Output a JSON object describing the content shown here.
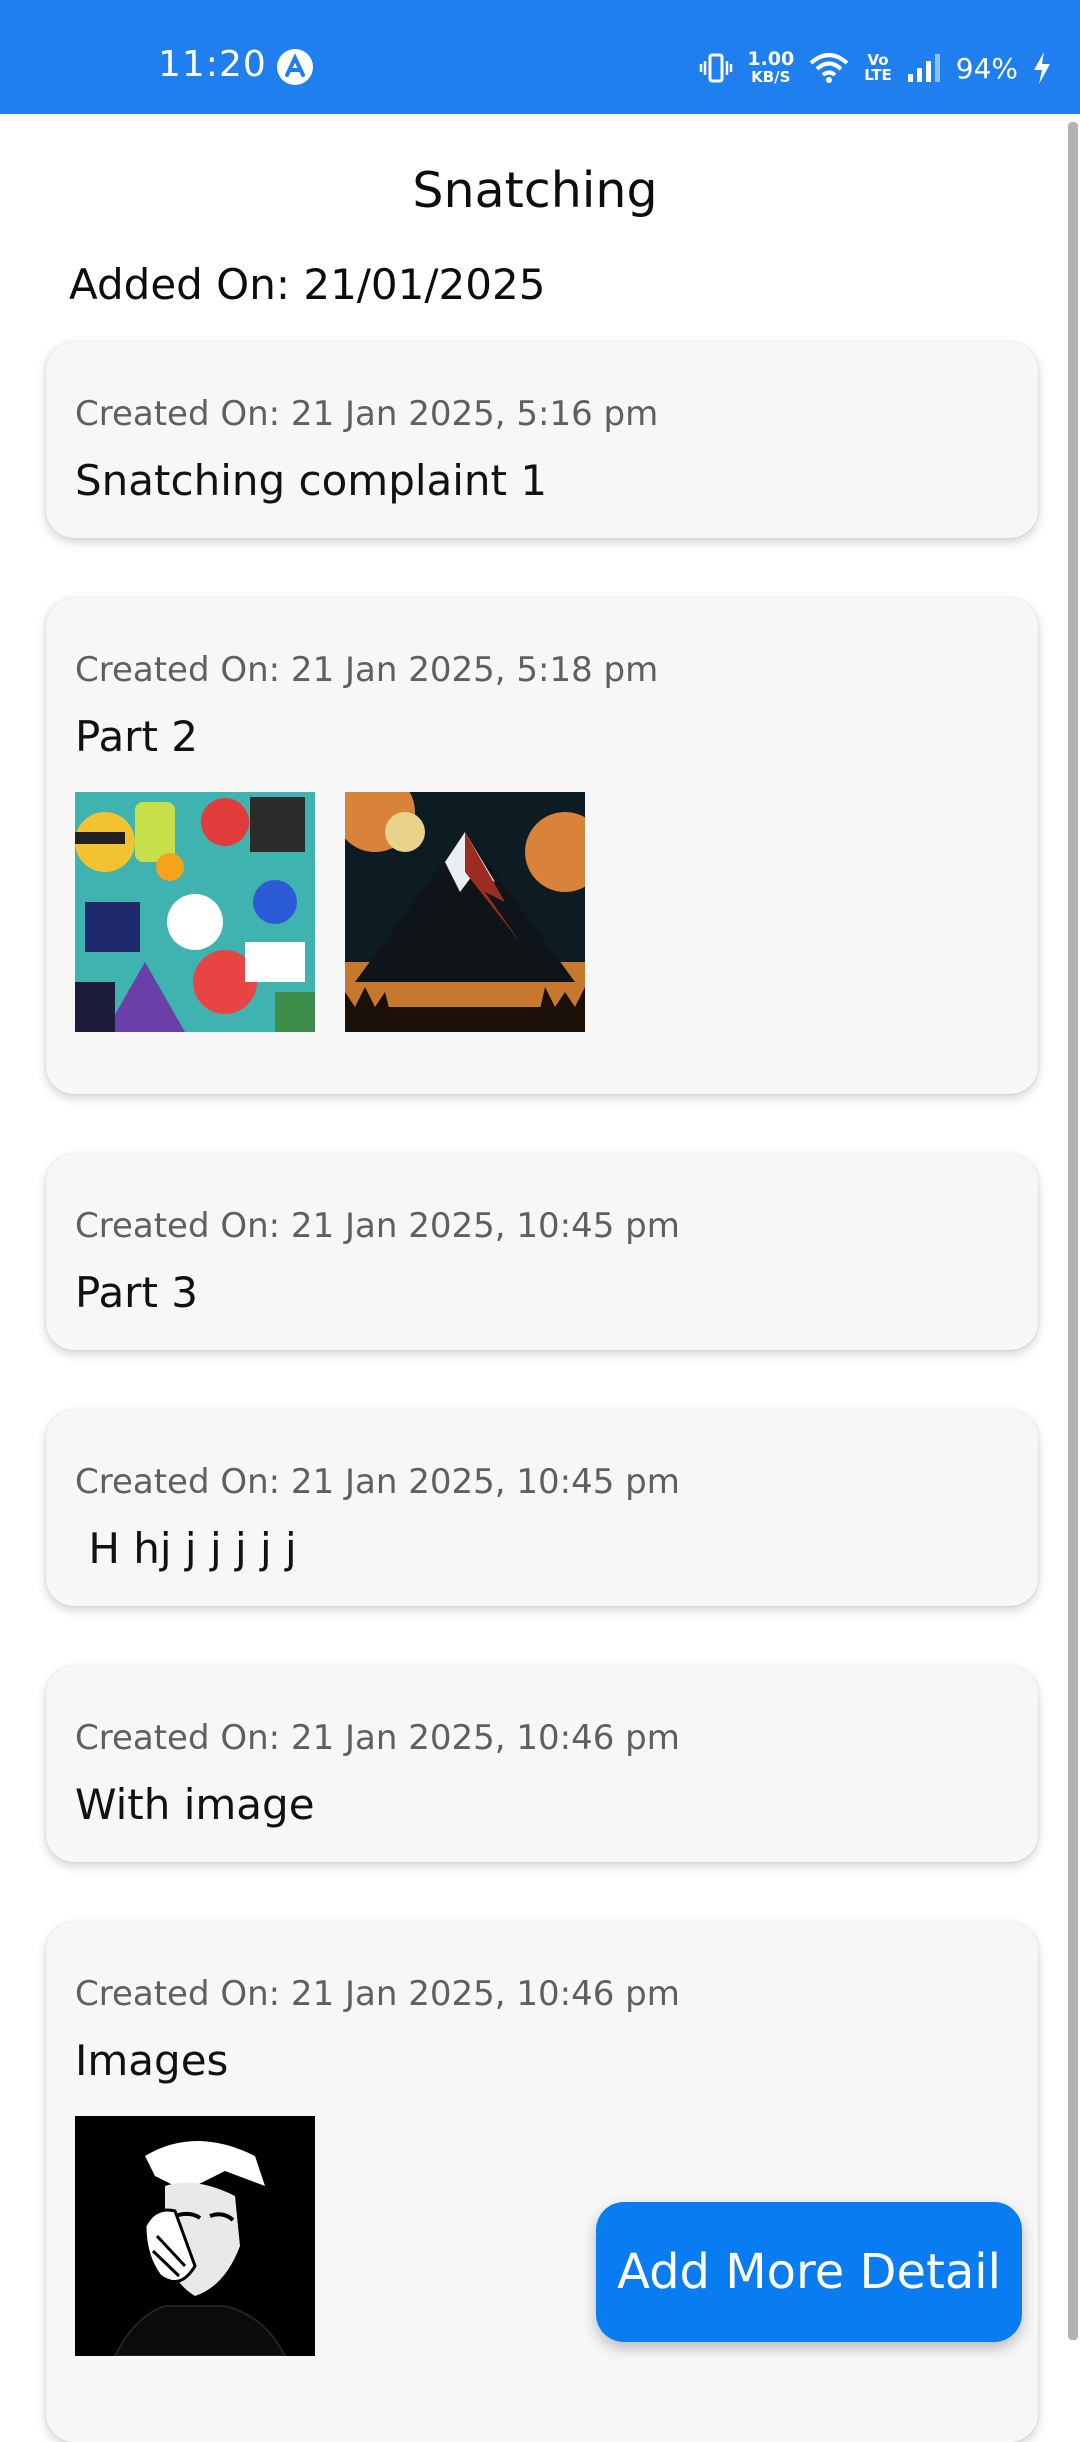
{
  "status_bar": {
    "time": "11:20",
    "speed_value": "1.00",
    "speed_unit": "KB/S",
    "volte_top": "Vo",
    "volte_bottom": "LTE",
    "battery": "94%",
    "accent_color": "#1f7fee"
  },
  "header": {
    "title": "Snatching",
    "added_on": "Added On: 21/01/2025"
  },
  "entries": [
    {
      "created": "Created On: 21 Jan 2025, 5:16 pm",
      "text": "Snatching complaint 1"
    },
    {
      "created": "Created On: 21 Jan 2025, 5:18 pm",
      "text": "Part 2",
      "images": [
        "sticker-collage-image",
        "mountain-night-image"
      ]
    },
    {
      "created": "Created On: 21 Jan 2025, 10:45 pm",
      "text": "Part 3"
    },
    {
      "created": "Created On: 21 Jan 2025, 10:45 pm",
      "text": " H hj j j j j j"
    },
    {
      "created": "Created On: 21 Jan 2025, 10:46 pm",
      "text": "With image"
    },
    {
      "created": "Created On: 21 Jan 2025, 10:46 pm",
      "text": "Images",
      "images": [
        "portrait-sketch-image"
      ]
    }
  ],
  "fab": {
    "label": "Add More Detail",
    "color": "#0a7cf2"
  }
}
